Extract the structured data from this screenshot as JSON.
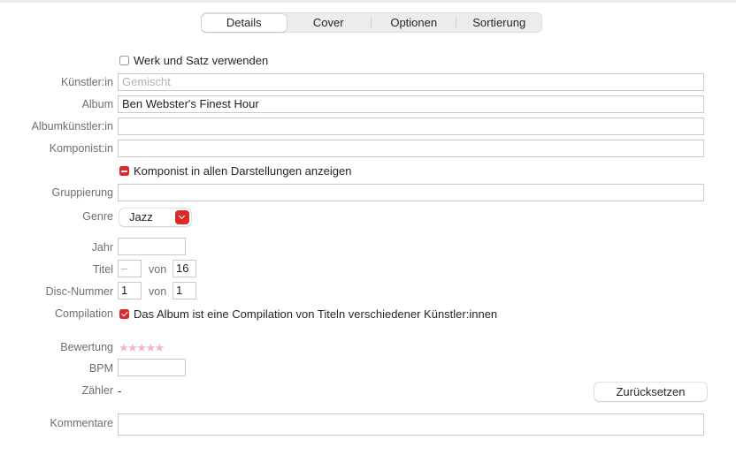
{
  "tabs": [
    "Details",
    "Cover",
    "Optionen",
    "Sortierung"
  ],
  "work_checkbox": {
    "label": "Werk und Satz verwenden",
    "checked": false
  },
  "fields": {
    "artist": {
      "label": "Künstler:in",
      "value": "",
      "placeholder": "Gemischt"
    },
    "album": {
      "label": "Album",
      "value": "Ben Webster's Finest Hour"
    },
    "album_artist": {
      "label": "Albumkünstler:in",
      "value": ""
    },
    "composer": {
      "label": "Komponist:in",
      "value": ""
    },
    "grouping": {
      "label": "Gruppierung",
      "value": ""
    }
  },
  "composer_checkbox": {
    "label": "Komponist in allen Darstellungen anzeigen",
    "state": "mixed"
  },
  "genre": {
    "label": "Genre",
    "value": "Jazz"
  },
  "year": {
    "label": "Jahr",
    "value": ""
  },
  "track": {
    "label": "Titel",
    "value": "–",
    "of_label": "von",
    "total": "16"
  },
  "disc": {
    "label": "Disc-Nummer",
    "value": "1",
    "of_label": "von",
    "total": "1"
  },
  "compilation": {
    "label": "Compilation",
    "checkbox_label": "Das Album ist eine Compilation von Titeln verschiedener Künstler:innen",
    "checked": true
  },
  "rating": {
    "label": "Bewertung",
    "stars": "★★★★★",
    "value": 0,
    "max": 5
  },
  "bpm": {
    "label": "BPM",
    "value": ""
  },
  "play_count": {
    "label": "Zähler",
    "value": "-",
    "reset_label": "Zurücksetzen"
  },
  "comments": {
    "label": "Kommentare",
    "value": ""
  },
  "colors": {
    "accent": "#d92b2b",
    "label": "#6e6e6e",
    "star_empty": "#f3b7bf"
  }
}
